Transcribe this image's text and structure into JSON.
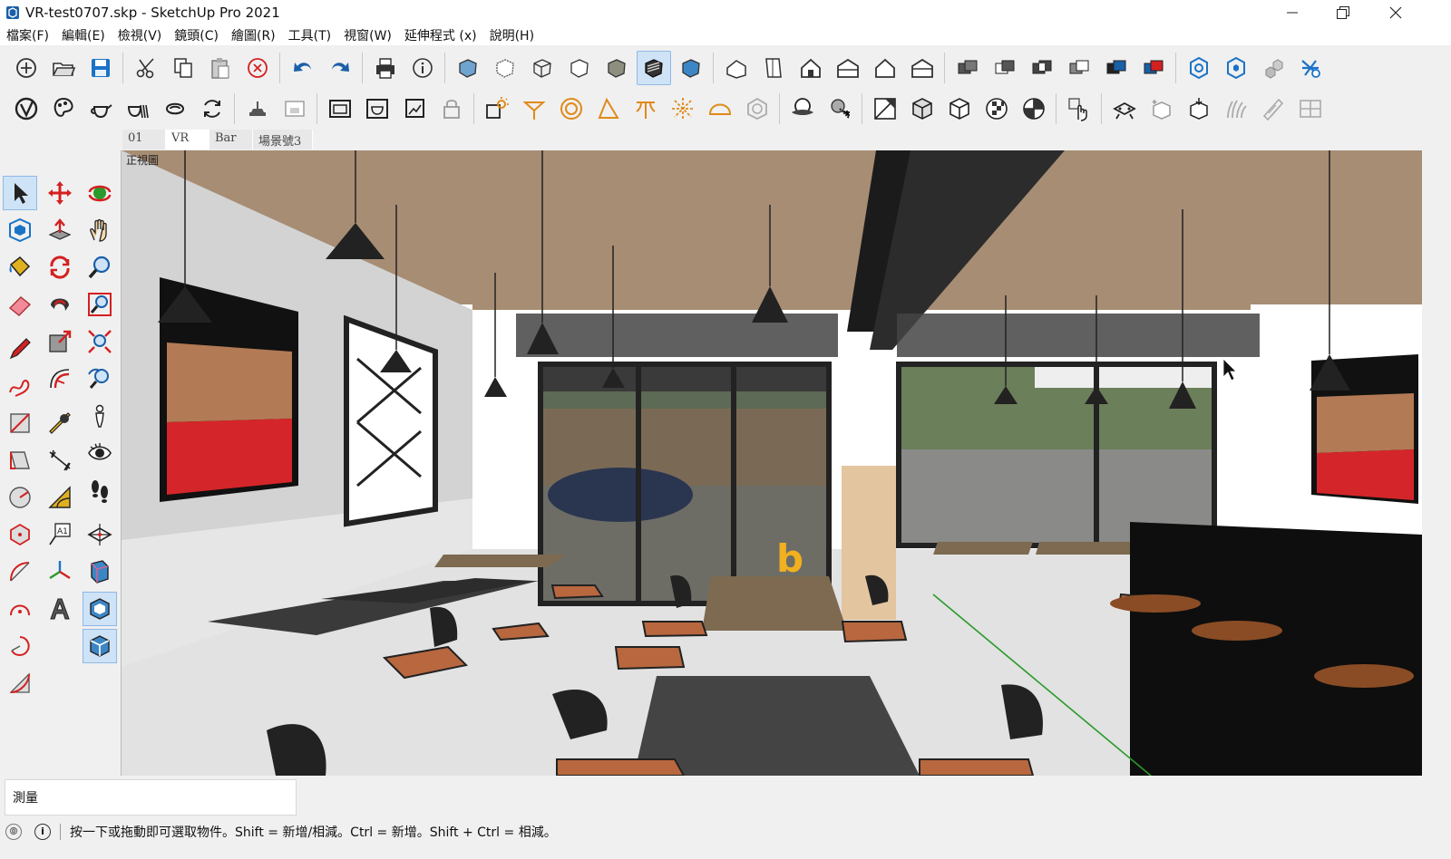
{
  "window": {
    "title": "VR-test0707.skp - SketchUp Pro 2021",
    "minimize_icon": "minimize-icon",
    "restore_icon": "restore-icon",
    "close_icon": "close-icon"
  },
  "menu": [
    "檔案(F)",
    "編輯(E)",
    "檢視(V)",
    "鏡頭(C)",
    "繪圖(R)",
    "工具(T)",
    "視窗(W)",
    "延伸程式 (x)",
    "說明(H)"
  ],
  "scene_tabs": [
    {
      "label": "01",
      "selected": false
    },
    {
      "label": "VR",
      "selected": true
    },
    {
      "label": "Bar",
      "selected": false
    },
    {
      "label": "場景號3",
      "selected": false
    }
  ],
  "viewport": {
    "view_label": "正視圖",
    "overlay_text": "b"
  },
  "measurements": {
    "label": "測量",
    "value": ""
  },
  "status": {
    "text": "按一下或拖動即可選取物件。Shift = 新增/相減。Ctrl = 新增。Shift + Ctrl = 相減。"
  },
  "colors": {
    "accent": "#1a73c7",
    "active_bg": "#cfe3f7",
    "overlay_b": "#f0b020"
  }
}
